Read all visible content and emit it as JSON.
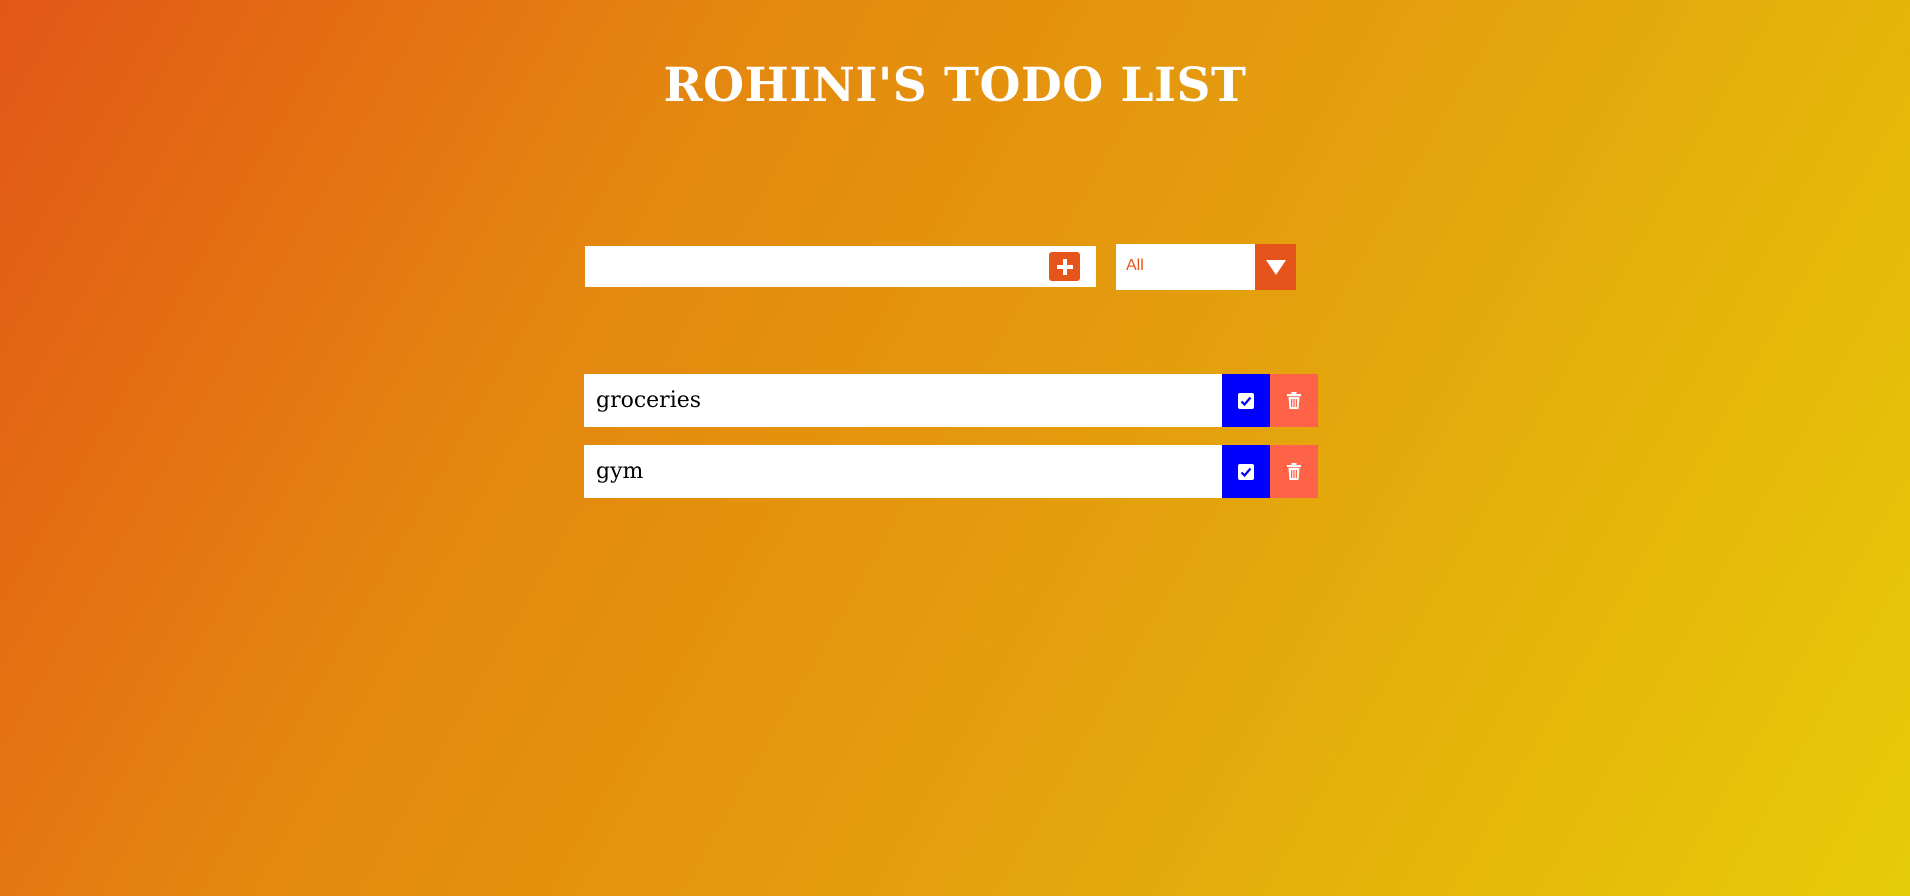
{
  "header": {
    "title": "ROHINI'S TODO LIST"
  },
  "form": {
    "input_value": "",
    "input_placeholder": "",
    "add_icon": "plus-square-icon",
    "filter": {
      "selected": "All",
      "arrow_icon": "caret-down-icon"
    }
  },
  "todos": [
    {
      "text": "groceries",
      "check_icon": "check-square-icon",
      "trash_icon": "trash-icon"
    },
    {
      "text": "gym",
      "check_icon": "check-square-icon",
      "trash_icon": "trash-icon"
    }
  ],
  "colors": {
    "accent": "#e5541a",
    "complete_button": "#0000ff",
    "delete_button": "#ff6347",
    "background_start": "#e35617",
    "background_end": "#e6cc08"
  }
}
